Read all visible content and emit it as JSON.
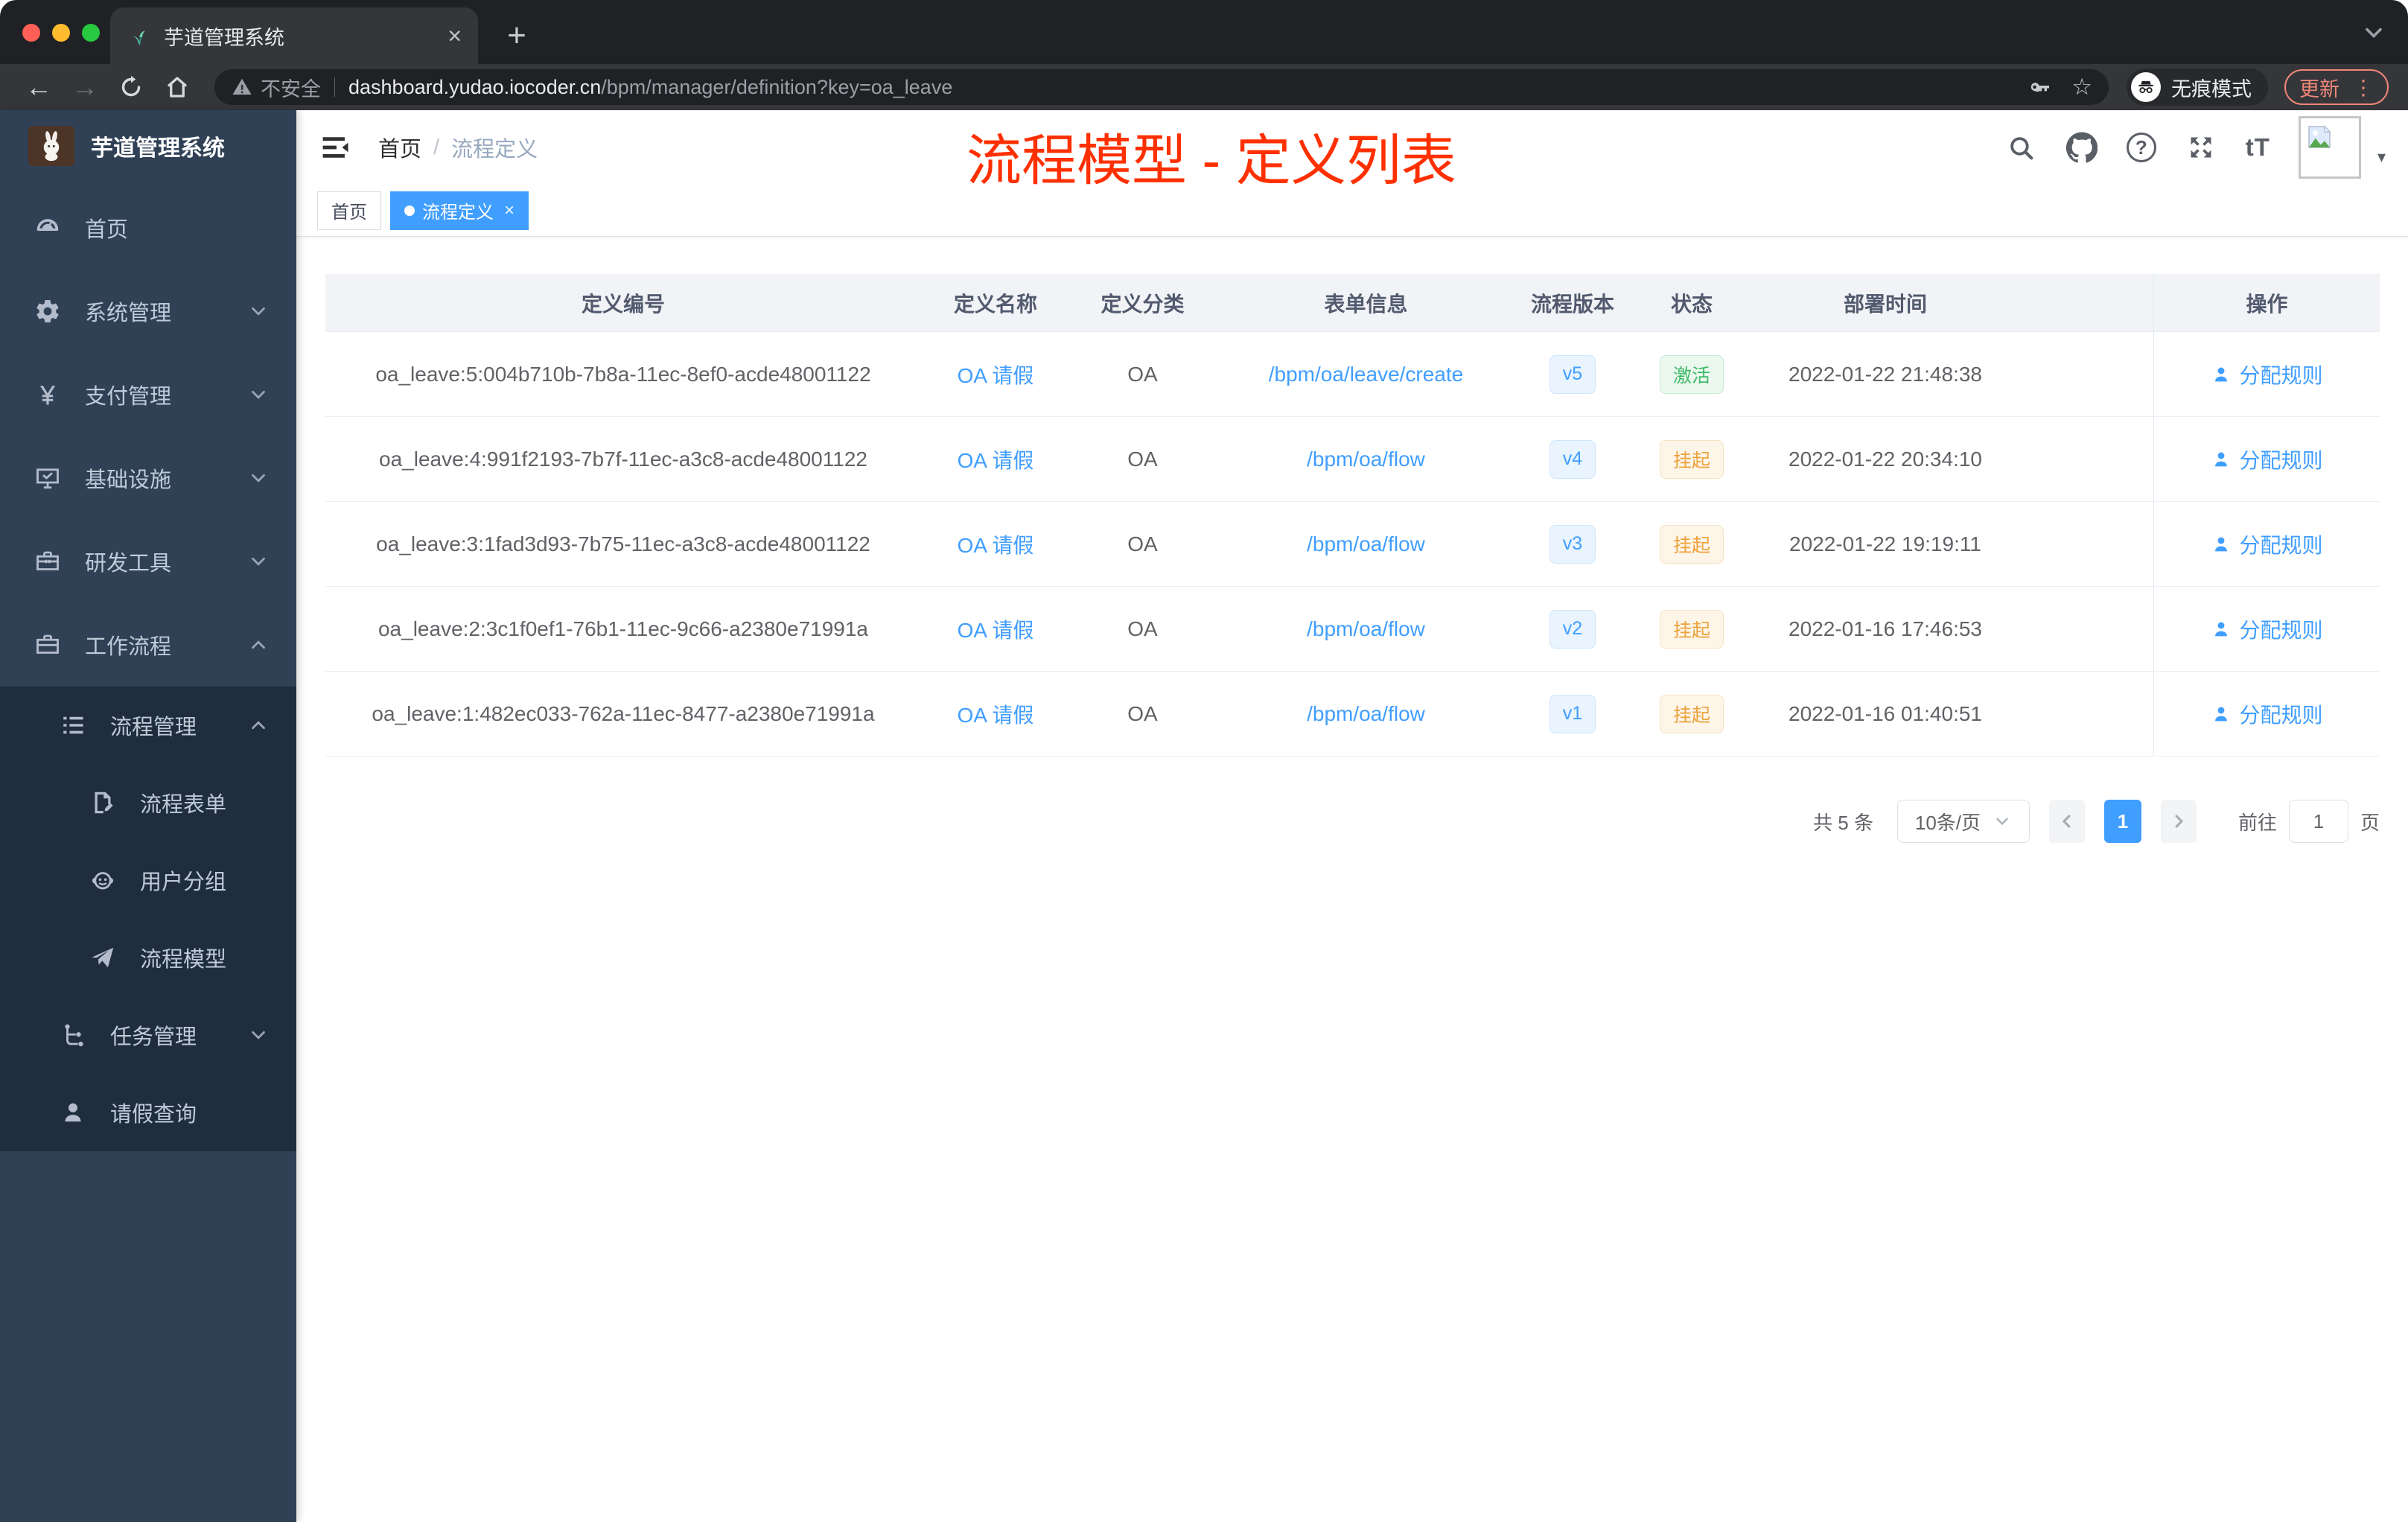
{
  "colors": {
    "accent": "#409eff",
    "sidebar_bg": "#304156",
    "sidebar_submenu_bg": "#1f2d3d",
    "annotation_red": "#ff3000",
    "update_salmon": "#f08779",
    "success_green": "#3db967",
    "warning_amber": "#eda23c"
  },
  "browser": {
    "tab_title": "芋道管理系统",
    "security_label": "不安全",
    "url_host": "dashboard.yudao.iocoder.cn",
    "url_path": "/bpm/manager/definition?key=oa_leave",
    "incognito_label": "无痕模式",
    "update_label": "更新"
  },
  "glyphs": {
    "close_tab": "×",
    "new_tab": "+",
    "back_arrow": "←",
    "forward_arrow": "→",
    "star": "☆",
    "more_dots": "⋮",
    "question_mark": "?",
    "text_size": "tT",
    "avatar_caret": "▾",
    "yen": "¥",
    "tag_close": "×"
  },
  "sidebar": {
    "brand": "芋道管理系统",
    "items": [
      {
        "label": "首页",
        "icon": "dashboard-icon",
        "level": 1,
        "chevron": ""
      },
      {
        "label": "系统管理",
        "icon": "gear-icon",
        "level": 1,
        "chevron": "down"
      },
      {
        "label": "支付管理",
        "icon": "yen-icon",
        "level": 1,
        "chevron": "down"
      },
      {
        "label": "基础设施",
        "icon": "monitor-icon",
        "level": 1,
        "chevron": "down"
      },
      {
        "label": "研发工具",
        "icon": "toolbox-icon",
        "level": 1,
        "chevron": "down"
      },
      {
        "label": "工作流程",
        "icon": "briefcase-icon",
        "level": 1,
        "chevron": "up"
      },
      {
        "label": "流程管理",
        "icon": "list-tree-icon",
        "level": 2,
        "chevron": "up",
        "dark": true
      },
      {
        "label": "流程表单",
        "icon": "form-edit-icon",
        "level": 3,
        "chevron": "",
        "dark": true
      },
      {
        "label": "用户分组",
        "icon": "robot-icon",
        "level": 3,
        "chevron": "",
        "dark": true
      },
      {
        "label": "流程模型",
        "icon": "paper-plane-icon",
        "level": 3,
        "chevron": "",
        "dark": true
      },
      {
        "label": "任务管理",
        "icon": "org-tree-icon",
        "level": 2,
        "chevron": "down",
        "dark": true
      },
      {
        "label": "请假查询",
        "icon": "user-icon",
        "level": 2,
        "chevron": "",
        "dark": true
      }
    ]
  },
  "navbar": {
    "breadcrumb_home": "首页",
    "breadcrumb_sep": "/",
    "breadcrumb_current": "流程定义",
    "annotation": "流程模型 - 定义列表"
  },
  "tags": [
    {
      "label": "首页",
      "active": false,
      "closable": false
    },
    {
      "label": "流程定义",
      "active": true,
      "closable": true
    }
  ],
  "table": {
    "headers": [
      "定义编号",
      "定义名称",
      "定义分类",
      "表单信息",
      "流程版本",
      "状态",
      "部署时间",
      "操作"
    ],
    "rows": [
      {
        "id": "oa_leave:5:004b710b-7b8a-11ec-8ef0-acde48001122",
        "name": "OA 请假",
        "category": "OA",
        "form": "/bpm/oa/leave/create",
        "version": "v5",
        "status": "激活",
        "status_type": "success",
        "deployed": "2022-01-22 21:48:38",
        "action": "分配规则"
      },
      {
        "id": "oa_leave:4:991f2193-7b7f-11ec-a3c8-acde48001122",
        "name": "OA 请假",
        "category": "OA",
        "form": "/bpm/oa/flow",
        "version": "v4",
        "status": "挂起",
        "status_type": "warning",
        "deployed": "2022-01-22 20:34:10",
        "action": "分配规则"
      },
      {
        "id": "oa_leave:3:1fad3d93-7b75-11ec-a3c8-acde48001122",
        "name": "OA 请假",
        "category": "OA",
        "form": "/bpm/oa/flow",
        "version": "v3",
        "status": "挂起",
        "status_type": "warning",
        "deployed": "2022-01-22 19:19:11",
        "action": "分配规则"
      },
      {
        "id": "oa_leave:2:3c1f0ef1-76b1-11ec-9c66-a2380e71991a",
        "name": "OA 请假",
        "category": "OA",
        "form": "/bpm/oa/flow",
        "version": "v2",
        "status": "挂起",
        "status_type": "warning",
        "deployed": "2022-01-16 17:46:53",
        "action": "分配规则"
      },
      {
        "id": "oa_leave:1:482ec033-762a-11ec-8477-a2380e71991a",
        "name": "OA 请假",
        "category": "OA",
        "form": "/bpm/oa/flow",
        "version": "v1",
        "status": "挂起",
        "status_type": "warning",
        "deployed": "2022-01-16 01:40:51",
        "action": "分配规则"
      }
    ]
  },
  "pagination": {
    "total": "共 5 条",
    "page_size": "10条/页",
    "current_page": "1",
    "goto_label": "前往",
    "goto_value": "1",
    "page_unit": "页"
  }
}
